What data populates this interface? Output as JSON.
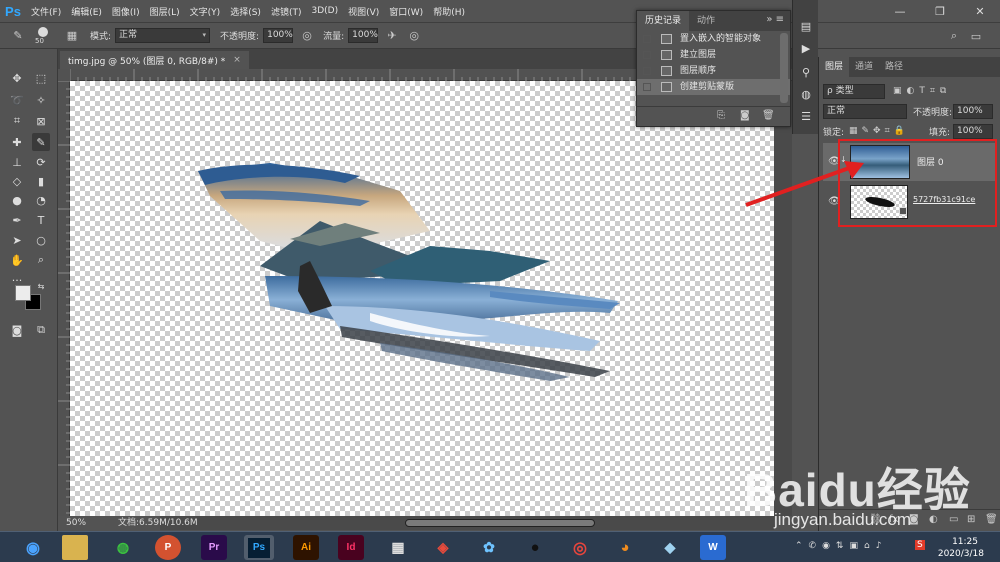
{
  "app": {
    "logo": "Ps"
  },
  "menu": [
    "文件(F)",
    "编辑(E)",
    "图像(I)",
    "图层(L)",
    "文字(Y)",
    "选择(S)",
    "滤镜(T)",
    "3D(D)",
    "视图(V)",
    "窗口(W)",
    "帮助(H)"
  ],
  "window_controls": {
    "minimize": "—",
    "restore": "❐",
    "close": "✕"
  },
  "options": {
    "brush_size": "50",
    "mode_label": "模式:",
    "mode_value": "正常",
    "opacity_label": "不透明度:",
    "opacity_value": "100%",
    "flow_label": "流量:",
    "flow_value": "100%"
  },
  "document": {
    "tab_title": "timg.jpg @ 50% (图层 0, RGB/8#) *",
    "zoom": "50%",
    "doc_info": "文档:6.59M/10.6M"
  },
  "history": {
    "tabs": [
      "历史记录",
      "动作"
    ],
    "items": [
      "置入嵌入的智能对象",
      "建立图层",
      "图层顺序",
      "创建剪贴蒙版"
    ],
    "selected_index": 3
  },
  "layers": {
    "tabs": [
      "图层",
      "通道",
      "路径"
    ],
    "filter_label": "ρ 类型",
    "blend_mode": "正常",
    "opacity_label": "不透明度:",
    "opacity_value": "100%",
    "lock_label": "锁定:",
    "fill_label": "填充:",
    "fill_value": "100%",
    "items": [
      {
        "name": "图层 0",
        "selected": true
      },
      {
        "name": "5727fb31c91ce",
        "selected": false
      }
    ]
  },
  "taskbar": {
    "apps": [
      "P",
      "Pr",
      "Ps",
      "Ai",
      "Id",
      "W"
    ],
    "time": "11:25",
    "date": "2020/3/18"
  },
  "watermark": {
    "text": "Baidu经验",
    "url": "jingyan.baidu.com"
  },
  "colors": {
    "ps_blue": "#31a8ff",
    "panel_bg": "#535353",
    "annotation_red": "#e12020",
    "taskbar": "#2c3b4e"
  }
}
